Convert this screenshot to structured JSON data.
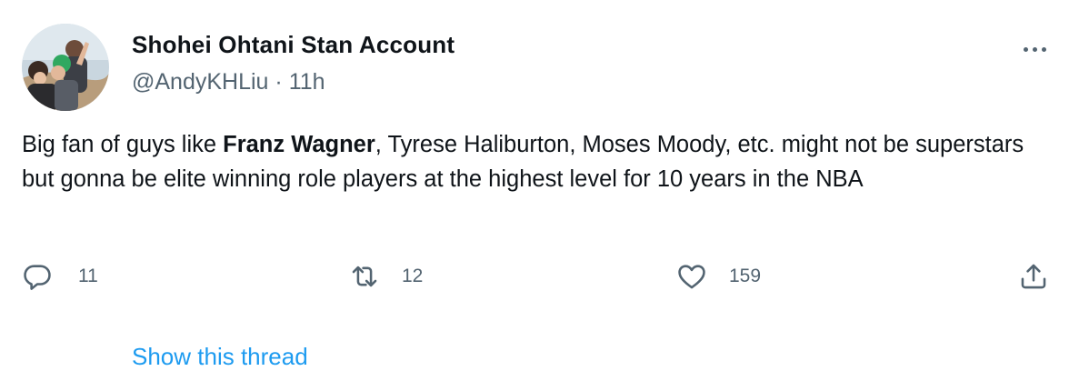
{
  "tweet": {
    "display_name": "Shohei Ohtani Stan Account",
    "handle": "@AndyKHLiu",
    "separator": "·",
    "time": "11h",
    "text_before": "Big fan of guys like ",
    "text_bold": "Franz Wagner",
    "text_after": ", Tyrese Haliburton, Moses Moody, etc. might not be superstars but gonna be elite winning role players at the highest level for 10 years in the NBA"
  },
  "actions": {
    "replies": "11",
    "retweets": "12",
    "likes": "159"
  },
  "show_thread_label": "Show this thread",
  "icons": {
    "more": "more-horizontal-icon",
    "reply": "reply-icon",
    "retweet": "retweet-icon",
    "like": "heart-icon",
    "share": "share-icon"
  },
  "colors": {
    "text": "#0f1419",
    "secondary": "#536471",
    "link": "#1d9bf0"
  }
}
